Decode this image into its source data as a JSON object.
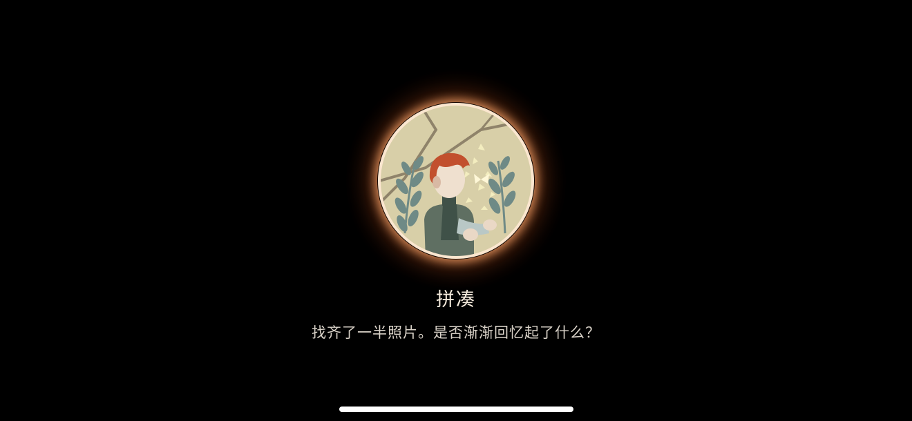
{
  "achievement": {
    "title": "拼凑",
    "description": "找齐了一半照片。是否渐渐回忆起了什么？",
    "badge_icon": "child-with-butterfly-badge",
    "glow_color": "#ff9a5a",
    "ring_color": "#fbe6cf"
  },
  "system": {
    "home_indicator": "home-indicator"
  }
}
